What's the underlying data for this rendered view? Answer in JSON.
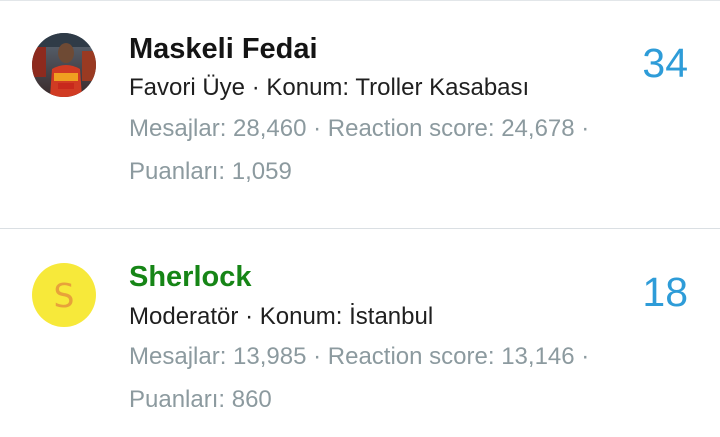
{
  "members": [
    {
      "name": "Maskeli Fedai",
      "title": "Favori Üye",
      "location_label": "Konum:",
      "location": "Troller Kasabası",
      "messages_label": "Mesajlar:",
      "messages": "28,460",
      "reaction_label": "Reaction score:",
      "reaction": "24,678",
      "points_label": "Puanları:",
      "points": "1,059",
      "count": "34",
      "avatar_type": "photo",
      "name_color": "#141414"
    },
    {
      "name": "Sherlock",
      "title": "Moderatör",
      "location_label": "Konum:",
      "location": "İstanbul",
      "messages_label": "Mesajlar:",
      "messages": "13,985",
      "reaction_label": "Reaction score:",
      "reaction": "13,146",
      "points_label": "Puanları:",
      "points": "860",
      "count": "18",
      "avatar_type": "letter",
      "avatar_letter": "S",
      "avatar_bg": "#f7e93a",
      "avatar_fg": "#e8a23a",
      "name_color": "#168516"
    }
  ],
  "separator": "·",
  "colors": {
    "count": "#2e9cd8",
    "muted": "#8c9a9f",
    "divider": "#dadfe3"
  }
}
